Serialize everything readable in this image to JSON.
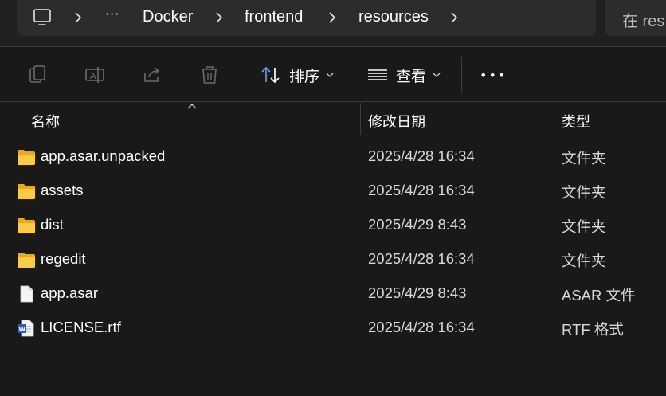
{
  "breadcrumb": {
    "more": "···",
    "items": [
      "Docker",
      "frontend",
      "resources"
    ]
  },
  "search": {
    "placeholder": "在 res"
  },
  "toolbar": {
    "sort_label": "排序",
    "view_label": "查看",
    "more_label": "•••"
  },
  "columns": {
    "name": "名称",
    "modified": "修改日期",
    "type": "类型"
  },
  "files": [
    {
      "name": "app.asar.unpacked",
      "modified": "2025/4/28 16:34",
      "type": "文件夹",
      "icon": "folder-icon"
    },
    {
      "name": "assets",
      "modified": "2025/4/28 16:34",
      "type": "文件夹",
      "icon": "folder-icon"
    },
    {
      "name": "dist",
      "modified": "2025/4/29 8:43",
      "type": "文件夹",
      "icon": "folder-icon"
    },
    {
      "name": "regedit",
      "modified": "2025/4/28 16:34",
      "type": "文件夹",
      "icon": "folder-icon"
    },
    {
      "name": "app.asar",
      "modified": "2025/4/29 8:43",
      "type": "ASAR 文件",
      "icon": "file-icon"
    },
    {
      "name": "LICENSE.rtf",
      "modified": "2025/4/28 16:34",
      "type": "RTF 格式",
      "icon": "word-doc-icon"
    }
  ],
  "colors": {
    "folder": "#f4c542",
    "background": "#191919",
    "accent": "#5aa0f0"
  }
}
